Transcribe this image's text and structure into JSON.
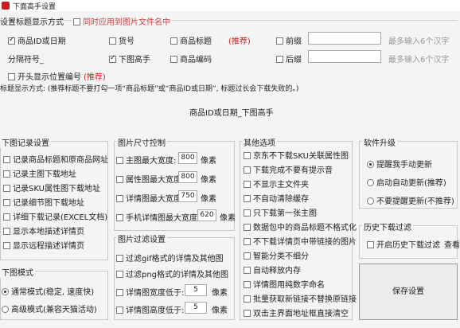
{
  "window": {
    "title": "下面高手设置"
  },
  "naming": {
    "section_title": "设置标题显示方式",
    "apply_to_image": "同时应用到图片文件名中",
    "opt_product_id_date": "商品ID或日期",
    "opt_item_no": "货号",
    "opt_product_title": "商品标题",
    "recommend": "(推荐)",
    "opt_prefix": "前缀",
    "max_hint": "最多输入6个汉字",
    "separator_label": "分隔符号_",
    "opt_download_master": "下图高手",
    "opt_product_code": "商品编码",
    "opt_suffix": "后缀",
    "show_position_no": "开头显示位置编号",
    "recommend2": "(推荐)",
    "title_format_note": "标题显示方式: (推荐标题不要打勾一项“商品标题”或“商品ID或日期”, 标题过长会下载失败的。)",
    "preview": "商品ID或日期_下图高手"
  },
  "record": {
    "title": "下图记录设置",
    "items": [
      "记录商品标题和原商品网址",
      "记录主图下载地址",
      "记录SKU属性图下载地址",
      "记录细节图下载地址",
      "详细下载记录(EXCEL文档)",
      "显示本地描述详情页",
      "显示远程描述详情页"
    ]
  },
  "mode": {
    "title": "下图模式",
    "normal": "通常模式(稳定, 速度快)",
    "advanced": "高级模式(兼容天猫活动)"
  },
  "size": {
    "title": "图片尺寸控制",
    "rows": [
      {
        "label": "主图最大宽度:",
        "value": "800",
        "unit": "像素",
        "checked": false
      },
      {
        "label": "属性图最大宽度:",
        "value": "800",
        "unit": "像素",
        "checked": false
      },
      {
        "label": "详情图最大宽度:",
        "value": "750",
        "unit": "像素",
        "checked": false
      },
      {
        "label": "手机详情图最大宽度:",
        "value": "620",
        "unit": "像素",
        "checked": false
      }
    ]
  },
  "filter": {
    "title": "图片过滤设置",
    "gif": "过滤gif格式的详情及其他图",
    "png": "过滤png格式的详情及其他图",
    "rows": [
      {
        "label": "详情图宽度低于:",
        "value": "5",
        "unit": "像素"
      },
      {
        "label": "详情图高度低于:",
        "value": "5",
        "unit": "像素"
      }
    ]
  },
  "other": {
    "title": "其他选项",
    "items": [
      "京东不下载SKU关联属性图",
      "下载完成不要有提示音",
      "不显示主文件夹",
      "不自动清除缓存",
      "只下载第一张主图",
      "数据包中的商品标题不格式化",
      "不下载详情页中带链接的图片",
      "智能分类不细分",
      "自动释放内存",
      "详情图用纯数字命名",
      "批量获取新链接不替换原链接",
      "双击主界面地址框直接清空"
    ]
  },
  "upgrade": {
    "title": "软件升级",
    "manual": "提醒我手动更新",
    "auto": "启动自动更新(推荐)",
    "never": "不要提醒更新(不推荐)"
  },
  "history": {
    "title": "历史下载过滤",
    "enable": "开启历史下载过滤",
    "view": "查看"
  },
  "save_button": "保存设置"
}
